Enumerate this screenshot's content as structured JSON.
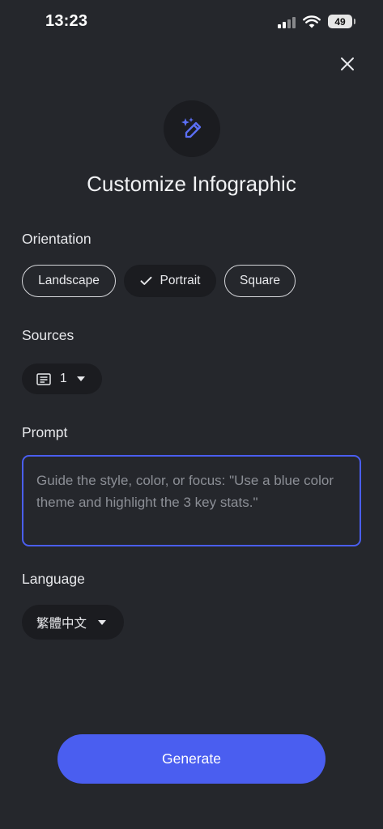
{
  "status": {
    "time": "13:23",
    "battery": "49"
  },
  "dialog": {
    "title": "Customize Infographic",
    "orientation": {
      "label": "Orientation",
      "options": [
        "Landscape",
        "Portrait",
        "Square"
      ],
      "selected": "Portrait"
    },
    "sources": {
      "label": "Sources",
      "count": "1"
    },
    "prompt": {
      "label": "Prompt",
      "value": "",
      "placeholder": "Guide the style, color, or focus: \"Use a blue color theme and highlight the 3 key stats.\""
    },
    "language": {
      "label": "Language",
      "selected": "繁體中文"
    },
    "generate_label": "Generate"
  },
  "colors": {
    "accent": "#4a5ef0",
    "background": "#25272c",
    "chip_selected": "#1b1c20"
  },
  "icons": [
    "close-icon",
    "magic-wand-icon",
    "check-icon",
    "document-icon",
    "dropdown-arrow-icon"
  ]
}
